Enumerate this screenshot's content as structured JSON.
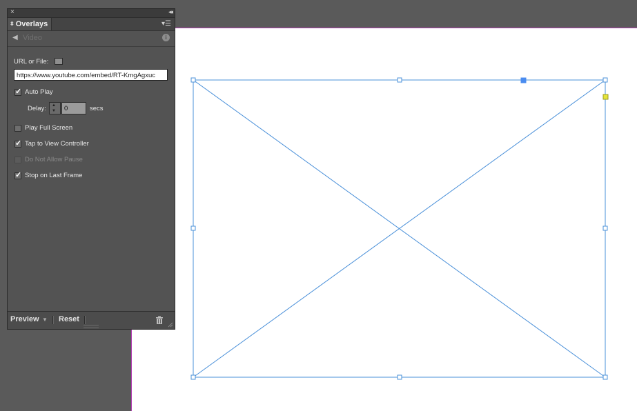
{
  "panel": {
    "close_glyph": "×",
    "collapse_glyph": "◂◂",
    "tab_label": "Overlays",
    "menu_icon": "panel-menu-icon",
    "overlay_type": "Video",
    "url_label": "URL or File:",
    "url_value": "https://www.youtube.com/embed/RT-KmgAgxuc",
    "auto_play_label": "Auto Play",
    "delay_label": "Delay:",
    "delay_value": "0",
    "delay_unit": "secs",
    "options": [
      {
        "label": "Play Full Screen",
        "checked": false,
        "disabled": false
      },
      {
        "label": "Tap to View Controller",
        "checked": true,
        "disabled": false
      },
      {
        "label": "Do Not Allow Pause",
        "checked": false,
        "disabled": true
      },
      {
        "label": "Stop on Last Frame",
        "checked": true,
        "disabled": false
      }
    ],
    "auto_play_checked": true,
    "preview_label": "Preview",
    "reset_label": "Reset"
  },
  "colors": {
    "frame_stroke": "#4a90d9",
    "page_edge": "#b23cb2",
    "anchor_selected": "#4a8cf0",
    "anchor_yellow": "#e4e43a"
  }
}
